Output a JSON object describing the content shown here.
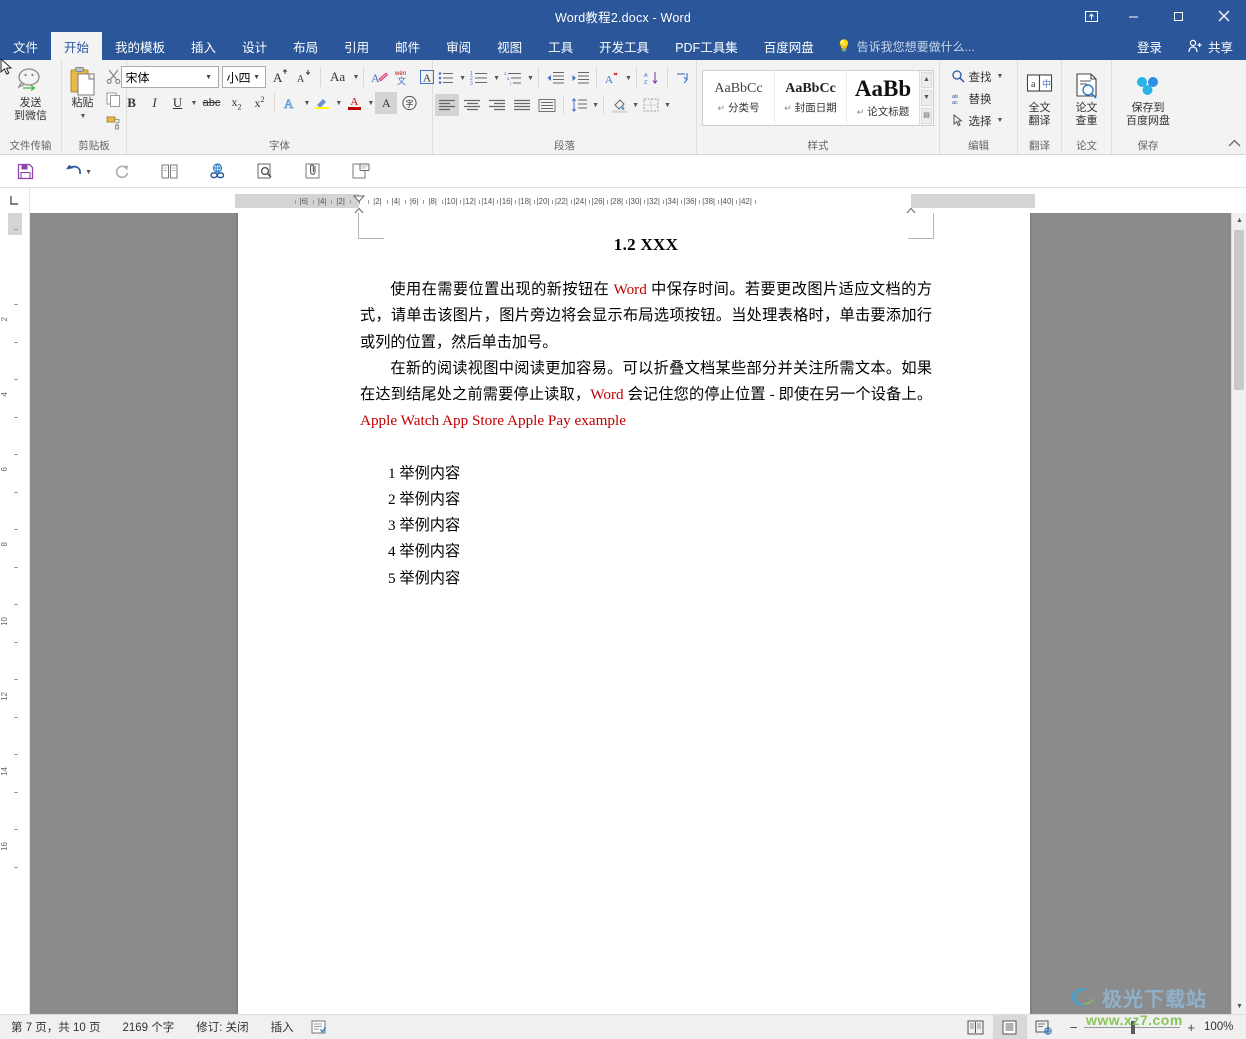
{
  "window": {
    "title": "Word教程2.docx - Word",
    "ribbon_display_icon": "ribbon-display-options-icon",
    "minimize": "—",
    "maximize": "❐",
    "close": "✕"
  },
  "tabs": [
    {
      "label": "文件",
      "active": false
    },
    {
      "label": "开始",
      "active": true
    },
    {
      "label": "我的模板",
      "active": false
    },
    {
      "label": "插入",
      "active": false
    },
    {
      "label": "设计",
      "active": false
    },
    {
      "label": "布局",
      "active": false
    },
    {
      "label": "引用",
      "active": false
    },
    {
      "label": "邮件",
      "active": false
    },
    {
      "label": "审阅",
      "active": false
    },
    {
      "label": "视图",
      "active": false
    },
    {
      "label": "工具",
      "active": false
    },
    {
      "label": "开发工具",
      "active": false
    },
    {
      "label": "PDF工具集",
      "active": false
    },
    {
      "label": "百度网盘",
      "active": false
    }
  ],
  "tellme": {
    "placeholder": "告诉我您想要做什么...",
    "icon": "lightbulb-icon"
  },
  "account": {
    "signin": "登录",
    "share": "共享"
  },
  "ribbon": {
    "groups": {
      "filetransfer": {
        "label": "文件传输",
        "send_wechat": "发送\n到微信",
        "send_wechat_l1": "发送",
        "send_wechat_l2": "到微信"
      },
      "clipboard": {
        "label": "剪贴板",
        "paste": "粘贴",
        "cut_tip": "剪切",
        "copy_tip": "复制",
        "formatpainter_tip": "格式刷"
      },
      "font": {
        "label": "字体",
        "font_name": "宋体",
        "font_size": "小四",
        "grow_tip": "增大字号",
        "shrink_tip": "减小字号",
        "changecase_tip": "更改大小写",
        "clearformat_tip": "清除所有格式",
        "phonetic_tip": "拼音指南",
        "charborder_tip": "字符边框",
        "bold": "B",
        "italic": "I",
        "underline": "U",
        "strike": "abc",
        "subscript": "x₂",
        "superscript": "x²",
        "texteffect_tip": "文本效果",
        "highlight_tip": "文本突出显示颜色",
        "fontcolor_tip": "字体颜色",
        "charshading_tip": "字符底纹",
        "enclose_tip": "带圈字符"
      },
      "paragraph": {
        "label": "段落",
        "bullets_tip": "项目符号",
        "numbering_tip": "编号",
        "multilevel_tip": "多级列表",
        "decindent_tip": "减少缩进量",
        "incindent_tip": "增加缩进量",
        "chinese_layout_tip": "中文版式",
        "sort_tip": "排序",
        "showmarks_tip": "显示编辑标记",
        "align_left_tip": "左对齐",
        "align_center_tip": "居中",
        "align_right_tip": "右对齐",
        "justify_tip": "两端对齐",
        "distribute_tip": "分散对齐",
        "linespacing_tip": "行和段落间距",
        "shading_tip": "底纹",
        "borders_tip": "边框"
      },
      "styles": {
        "label": "样式",
        "items": [
          {
            "preview": "AaBbCc",
            "name": "分类号",
            "size": 14
          },
          {
            "preview": "AaBbCc",
            "name": "封面日期",
            "size": 14
          },
          {
            "preview": "AaBb",
            "name": "论文标题",
            "size": 22
          }
        ]
      },
      "editing": {
        "label": "编辑",
        "find": "查找",
        "replace": "替换",
        "select": "选择"
      },
      "translate": {
        "label": "翻译",
        "btn_l1": "全文",
        "btn_l2": "翻译"
      },
      "thesis": {
        "label": "论文",
        "btn_l1": "论文",
        "btn_l2": "查重"
      },
      "save": {
        "label": "保存",
        "btn_l1": "保存到",
        "btn_l2": "百度网盘"
      }
    },
    "collapse_icon": "collapse-ribbon-chevron-icon"
  },
  "quick_toolbar": [
    {
      "name": "save-icon",
      "glyph": "save"
    },
    {
      "name": "undo-icon",
      "glyph": "undo",
      "caret": true
    },
    {
      "name": "redo-icon",
      "glyph": "redo"
    },
    {
      "name": "compare-documents-icon",
      "glyph": "compare"
    },
    {
      "name": "insert-hyperlink-icon",
      "glyph": "link"
    },
    {
      "name": "print-preview-icon",
      "glyph": "preview"
    },
    {
      "name": "attach-file-icon",
      "glyph": "attach"
    },
    {
      "name": "new-comment-icon",
      "glyph": "comment"
    }
  ],
  "ruler": {
    "corner_icon": "tab-stop-left-icon",
    "h_ticks": [
      6,
      4,
      2,
      2,
      4,
      6,
      8,
      10,
      12,
      14,
      16,
      18,
      20,
      22,
      24,
      26,
      28,
      30,
      32,
      34,
      36,
      38,
      40,
      42
    ],
    "v_ticks": [
      2,
      4,
      6,
      8,
      10,
      12,
      14,
      16
    ]
  },
  "document": {
    "heading": "1.2 XXX",
    "paragraphs": [
      {
        "runs": [
          {
            "t": "使用在需要位置出现的新按钮在 ",
            "c": "black"
          },
          {
            "t": "Word",
            "c": "red"
          },
          {
            "t": " 中保存时间。若要更改图片适应文档的方式，请单击该图片，图片旁边将会显示布局选项按钮。当处理表格时，单击要添加行或列的位置，然后单击加号。",
            "c": "black"
          }
        ]
      },
      {
        "runs": [
          {
            "t": "在新的阅读视图中阅读更加容易。可以折叠文档某些部分并关注所需文本。如果在达到结尾处之前需要停止读取，",
            "c": "black"
          },
          {
            "t": "Word",
            "c": "red"
          },
          {
            "t": " 会记住您的停止位置 - 即使在另一个设备上。",
            "c": "black"
          },
          {
            "t": "Apple Watch",
            "c": "red"
          },
          {
            "t": "   ",
            "c": "black"
          },
          {
            "t": "App Store",
            "c": "red"
          },
          {
            "t": "   ",
            "c": "black"
          },
          {
            "t": "Apple Pay",
            "c": "red"
          },
          {
            "t": "   ",
            "c": "black"
          },
          {
            "t": "example",
            "c": "red"
          }
        ]
      }
    ],
    "list": [
      {
        "num": "1",
        "text": "举例内容"
      },
      {
        "num": "2",
        "text": "举例内容"
      },
      {
        "num": "3",
        "text": "举例内容"
      },
      {
        "num": "4",
        "text": "举例内容"
      },
      {
        "num": "5",
        "text": "举例内容"
      }
    ]
  },
  "statusbar": {
    "page_info": "第 7 页，共 10 页",
    "word_count": "2169 个字",
    "track_changes": "修订: 关闭",
    "overtype": "插入",
    "proofing_icon": "proofing-errors-icon",
    "views": [
      {
        "name": "read-mode-view",
        "active": false
      },
      {
        "name": "print-layout-view",
        "active": true
      },
      {
        "name": "web-layout-view",
        "active": false
      }
    ],
    "zoom_out": "−",
    "zoom_in": "+",
    "zoom_level": "100%"
  },
  "watermark": {
    "brand": "极光下载站",
    "url": "www.xz7.com"
  },
  "colors": {
    "word_blue": "#2b579a",
    "ribbon_bg": "#f3f3f3",
    "doc_gray": "#8b8b8b",
    "accent_red": "#c00000",
    "watermark_blue": "#8fb8d8",
    "watermark_green": "#7fc24a"
  }
}
